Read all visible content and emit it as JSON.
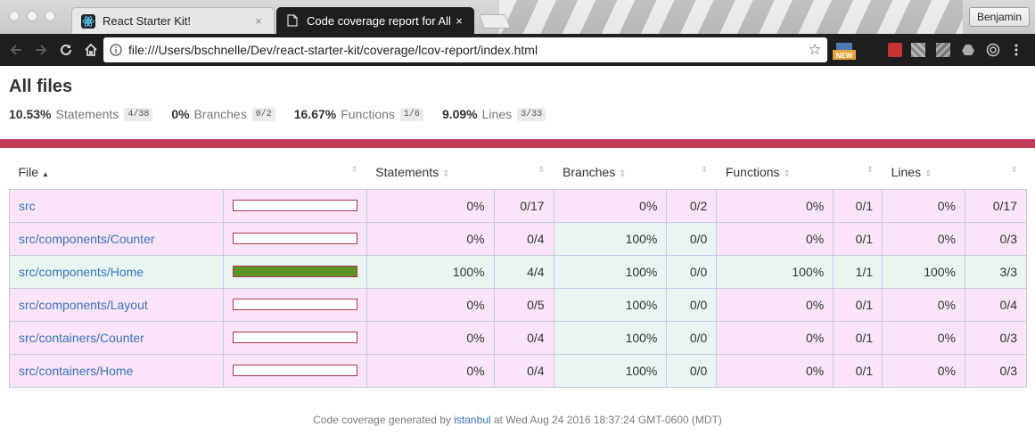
{
  "browser": {
    "tabs": [
      {
        "title": "React Starter Kit!",
        "close": "×"
      },
      {
        "title": "Code coverage report for All files",
        "close": "×"
      }
    ],
    "profile": "Benjamin",
    "url": "file:///Users/bschnelle/Dev/react-starter-kit/coverage/lcov-report/index.html",
    "ext_new_badge": "NEW"
  },
  "page": {
    "title": "All files",
    "summary": [
      {
        "pct": "10.53%",
        "name": "Statements",
        "frac": "4/38"
      },
      {
        "pct": "0%",
        "name": "Branches",
        "frac": "0/2"
      },
      {
        "pct": "16.67%",
        "name": "Functions",
        "frac": "1/6"
      },
      {
        "pct": "9.09%",
        "name": "Lines",
        "frac": "3/33"
      }
    ],
    "status_color": "#c2405a"
  },
  "table": {
    "headers": {
      "file": "File",
      "statements": "Statements",
      "branches": "Branches",
      "functions": "Functions",
      "lines": "Lines"
    },
    "sort_asc_glyph": "▲",
    "sort_glyph": "⇕",
    "rows": [
      {
        "file": "src",
        "coverage": 0,
        "s_pct": "0%",
        "s_frac": "0/17",
        "b_pct": "0%",
        "b_frac": "0/2",
        "f_pct": "0%",
        "f_frac": "0/1",
        "l_pct": "0%",
        "l_frac": "0/17",
        "row_class": "low",
        "b_high": false
      },
      {
        "file": "src/components/Counter",
        "coverage": 0,
        "s_pct": "0%",
        "s_frac": "0/4",
        "b_pct": "100%",
        "b_frac": "0/0",
        "f_pct": "0%",
        "f_frac": "0/1",
        "l_pct": "0%",
        "l_frac": "0/3",
        "row_class": "low",
        "b_high": true
      },
      {
        "file": "src/components/Home",
        "coverage": 1,
        "s_pct": "100%",
        "s_frac": "4/4",
        "b_pct": "100%",
        "b_frac": "0/0",
        "f_pct": "100%",
        "f_frac": "1/1",
        "l_pct": "100%",
        "l_frac": "3/3",
        "row_class": "high",
        "b_high": true
      },
      {
        "file": "src/components/Layout",
        "coverage": 0,
        "s_pct": "0%",
        "s_frac": "0/5",
        "b_pct": "100%",
        "b_frac": "0/0",
        "f_pct": "0%",
        "f_frac": "0/1",
        "l_pct": "0%",
        "l_frac": "0/4",
        "row_class": "low",
        "b_high": true
      },
      {
        "file": "src/containers/Counter",
        "coverage": 0,
        "s_pct": "0%",
        "s_frac": "0/4",
        "b_pct": "100%",
        "b_frac": "0/0",
        "f_pct": "0%",
        "f_frac": "0/1",
        "l_pct": "0%",
        "l_frac": "0/3",
        "row_class": "low",
        "b_high": true
      },
      {
        "file": "src/containers/Home",
        "coverage": 0,
        "s_pct": "0%",
        "s_frac": "0/4",
        "b_pct": "100%",
        "b_frac": "0/0",
        "f_pct": "0%",
        "f_frac": "0/1",
        "l_pct": "0%",
        "l_frac": "0/3",
        "row_class": "low",
        "b_high": true
      }
    ]
  },
  "footer": {
    "prefix": "Code coverage generated by",
    "link": "istanbul",
    "suffix": "at Wed Aug 24 2016 18:37:24 GMT-0600 (MDT)"
  }
}
